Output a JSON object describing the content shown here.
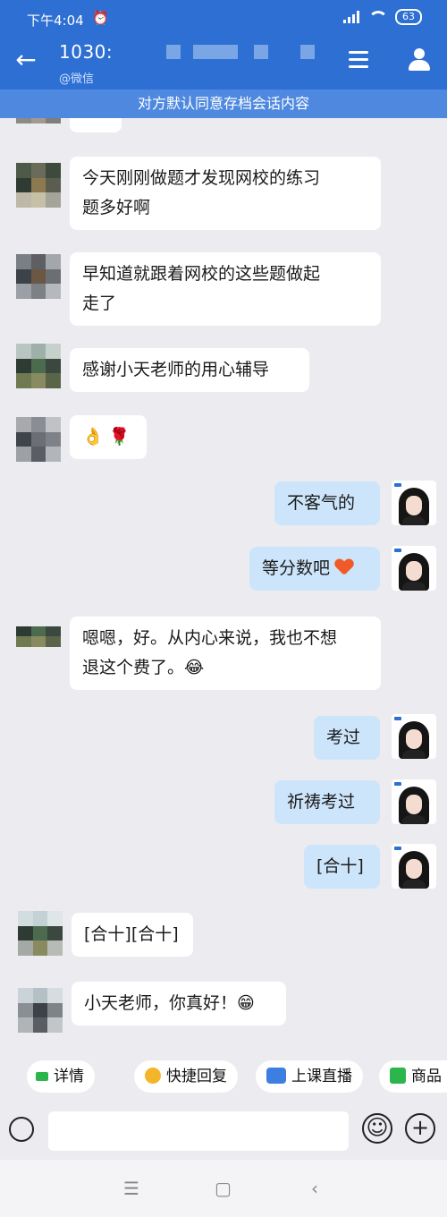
{
  "status": {
    "time": "下午4:04",
    "battery": "63"
  },
  "header": {
    "title": "1030:",
    "subtitle": "@微信"
  },
  "notice": "对方默认同意存档会话内容",
  "messages": [
    {
      "from": "student",
      "text": "今天刚刚做题才发现网校的练习",
      "text2": "题多好啊"
    },
    {
      "from": "student",
      "text": "早知道就跟着网校的这些题做起",
      "text2": "走了"
    },
    {
      "from": "student",
      "text": "感谢小天老师的用心辅导"
    },
    {
      "from": "student",
      "text": "👌 🌹"
    },
    {
      "from": "teacher",
      "text": "不客气的"
    },
    {
      "from": "teacher",
      "text": "等分数吧"
    },
    {
      "from": "student",
      "text": "嗯嗯，好。从内心来说，我也不想",
      "text2": "退这个费了。😂"
    },
    {
      "from": "teacher",
      "text": "考过"
    },
    {
      "from": "teacher",
      "text": "祈祷考过"
    },
    {
      "from": "teacher",
      "text": "[合十]"
    },
    {
      "from": "student",
      "text": "[合十][合十]"
    },
    {
      "from": "student",
      "text": "小天老师，你真好！😁"
    }
  ],
  "quick_actions": [
    {
      "label": "详情"
    },
    {
      "label": "快捷回复",
      "icon": "quick-reply-icon",
      "color": "#f5b52a"
    },
    {
      "label": "上课直播",
      "icon": "live-icon",
      "color": "#3d7fe0"
    },
    {
      "label": "商品",
      "icon": "goods-icon",
      "color": "#2cb54d"
    }
  ],
  "colors": {
    "primary": "#2d6fd2",
    "notice_bg": "#4f89df",
    "outgoing_bubble": "#cde5fb",
    "incoming_bubble": "#ffffff",
    "chat_bg": "#ececf0"
  }
}
